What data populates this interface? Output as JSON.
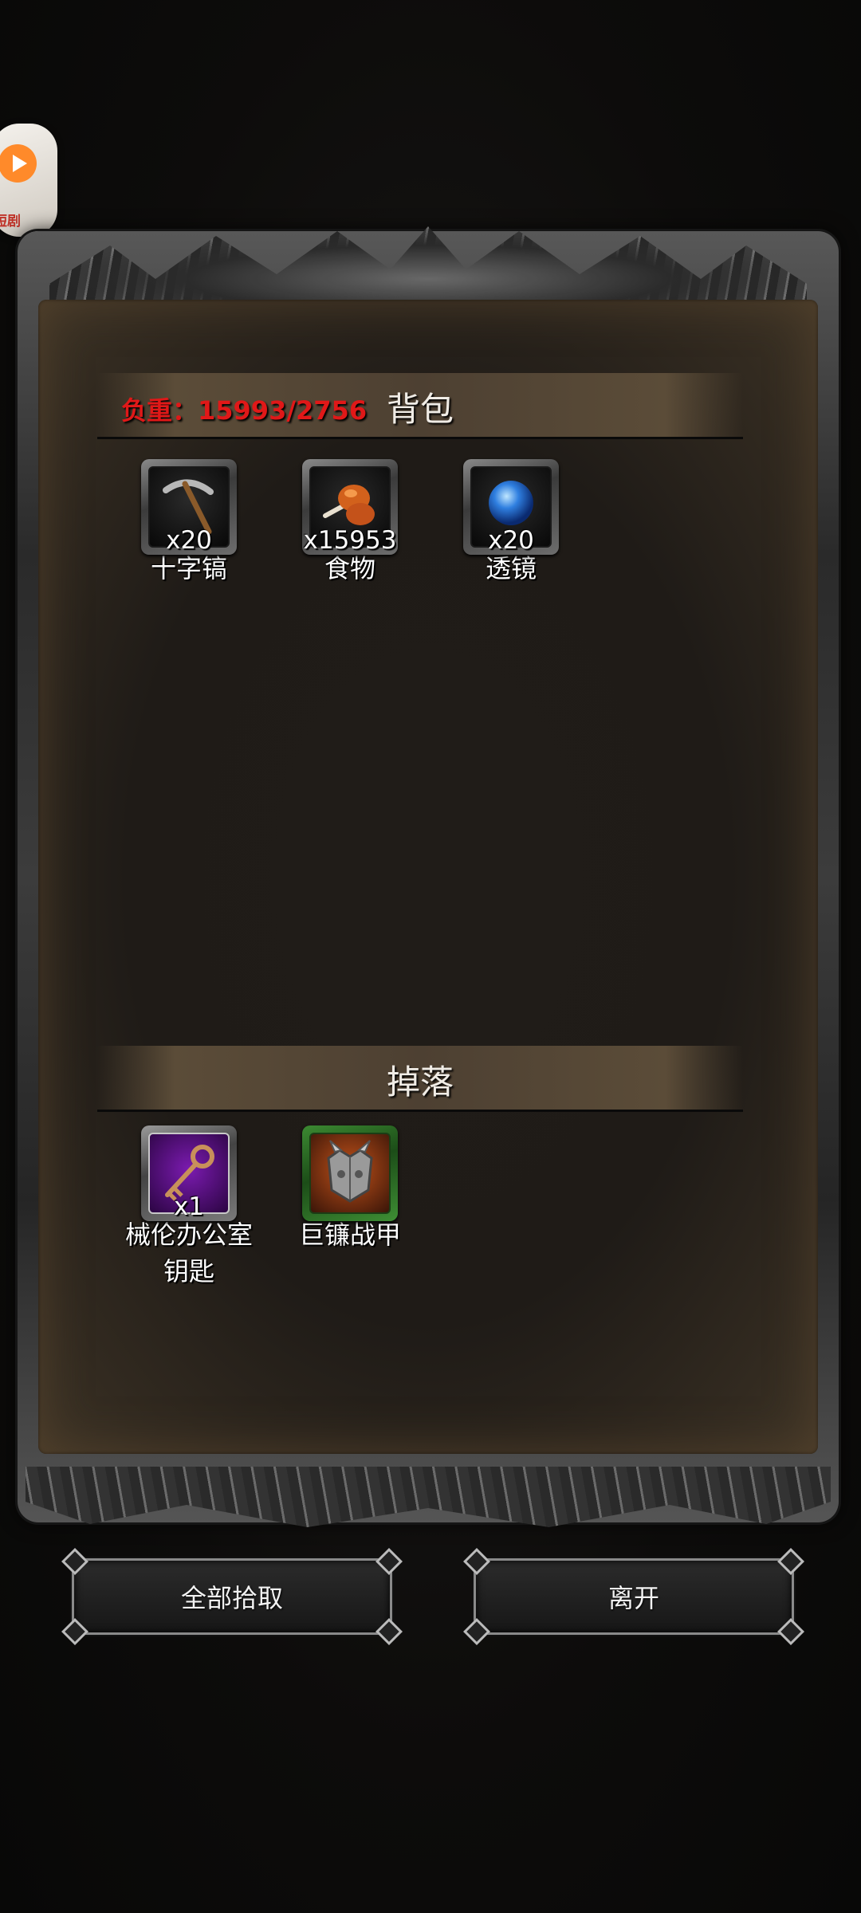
{
  "floating_widget": {
    "label": "短剧",
    "icon": "play-icon"
  },
  "backpack": {
    "title": "背包",
    "weight_label": "负重：15993/2756",
    "items": [
      {
        "name": "十字镐",
        "count": "x20",
        "icon": "pickaxe-icon"
      },
      {
        "name": "食物",
        "count": "x15953",
        "icon": "meat-icon"
      },
      {
        "name": "透镜",
        "count": "x20",
        "icon": "lens-orb-icon"
      }
    ]
  },
  "drops": {
    "title": "掉落",
    "items": [
      {
        "name": "械伦办公室\n钥匙",
        "name_line1": "械伦办公室",
        "name_line2": "钥匙",
        "count": "x1",
        "icon": "key-icon"
      },
      {
        "name": "巨镰战甲",
        "count": "",
        "icon": "armor-icon"
      }
    ]
  },
  "buttons": {
    "pick_all": "全部拾取",
    "leave": "离开"
  },
  "colors": {
    "weight_text": "#e01818",
    "panel_bg": "#1f1b17",
    "header_bg": "#4d4032"
  }
}
